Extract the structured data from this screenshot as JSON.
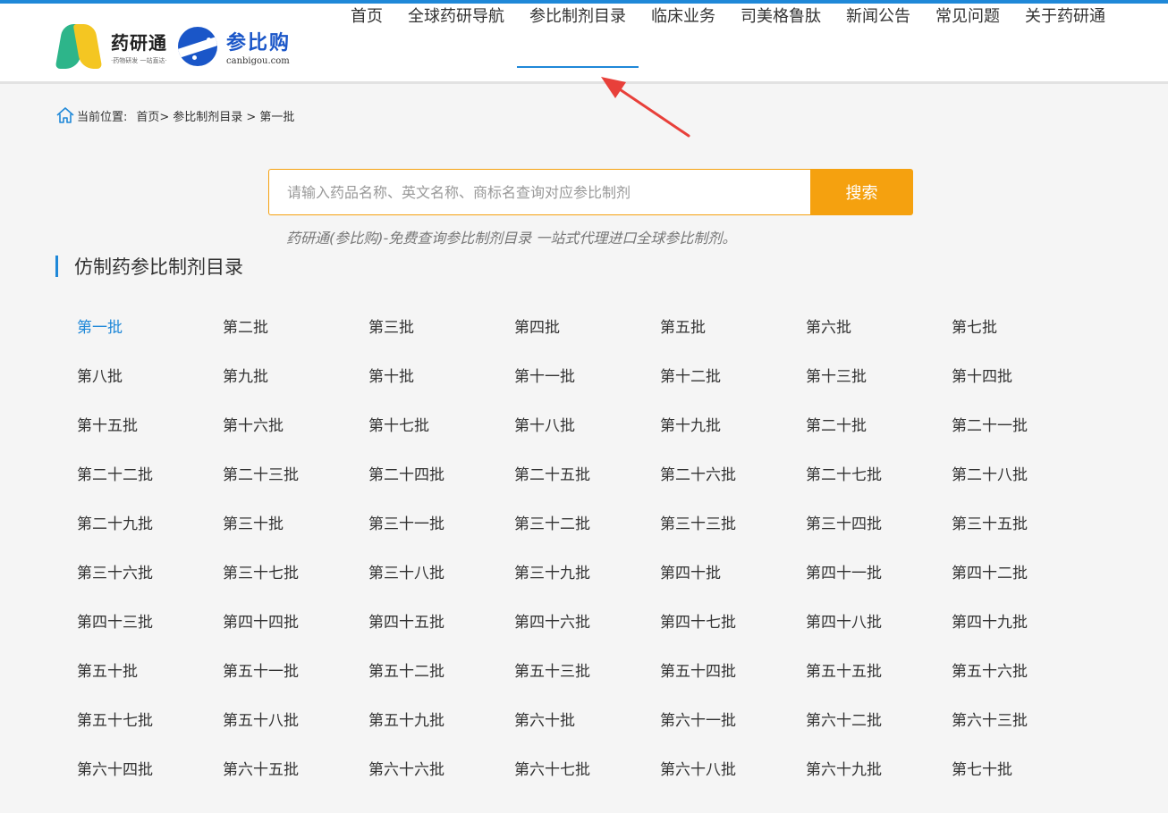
{
  "header": {
    "logo1_name": "药研通",
    "logo1_slogan": "·药物研发 一站直达·",
    "logo2_name": "参比购",
    "logo2_domain": "canbigou.com"
  },
  "nav": {
    "items": [
      {
        "label": "首页"
      },
      {
        "label": "全球药研导航"
      },
      {
        "label": "参比制剂目录",
        "active": true
      },
      {
        "label": "临床业务"
      },
      {
        "label": "司美格鲁肽"
      },
      {
        "label": "新闻公告"
      },
      {
        "label": "常见问题"
      },
      {
        "label": "关于药研通"
      }
    ]
  },
  "breadcrumb": {
    "prefix": "当前位置:",
    "home": "首页>",
    "catalog": "参比制剂目录 >",
    "current": "第一批"
  },
  "search": {
    "placeholder": "请输入药品名称、英文名称、商标名查询对应参比制剂",
    "button_label": "搜索",
    "tagline": "药研通(参比购)-免费查询参比制剂目录 一站式代理进口全球参比制剂。"
  },
  "section": {
    "title": "仿制药参比制剂目录"
  },
  "batches": [
    "第一批",
    "第二批",
    "第三批",
    "第四批",
    "第五批",
    "第六批",
    "第七批",
    "第八批",
    "第九批",
    "第十批",
    "第十一批",
    "第十二批",
    "第十三批",
    "第十四批",
    "第十五批",
    "第十六批",
    "第十七批",
    "第十八批",
    "第十九批",
    "第二十批",
    "第二十一批",
    "第二十二批",
    "第二十三批",
    "第二十四批",
    "第二十五批",
    "第二十六批",
    "第二十七批",
    "第二十八批",
    "第二十九批",
    "第三十批",
    "第三十一批",
    "第三十二批",
    "第三十三批",
    "第三十四批",
    "第三十五批",
    "第三十六批",
    "第三十七批",
    "第三十八批",
    "第三十九批",
    "第四十批",
    "第四十一批",
    "第四十二批",
    "第四十三批",
    "第四十四批",
    "第四十五批",
    "第四十六批",
    "第四十七批",
    "第四十八批",
    "第四十九批",
    "第五十批",
    "第五十一批",
    "第五十二批",
    "第五十三批",
    "第五十四批",
    "第五十五批",
    "第五十六批",
    "第五十七批",
    "第五十八批",
    "第五十九批",
    "第六十批",
    "第六十一批",
    "第六十二批",
    "第六十三批",
    "第六十四批",
    "第六十五批",
    "第六十六批",
    "第六十七批",
    "第六十八批",
    "第六十九批",
    "第七十批"
  ],
  "current_batch": "第一批",
  "colors": {
    "accent_blue": "#1f88d8",
    "search_orange": "#f5a10f",
    "arrow_red": "#e8403a"
  }
}
